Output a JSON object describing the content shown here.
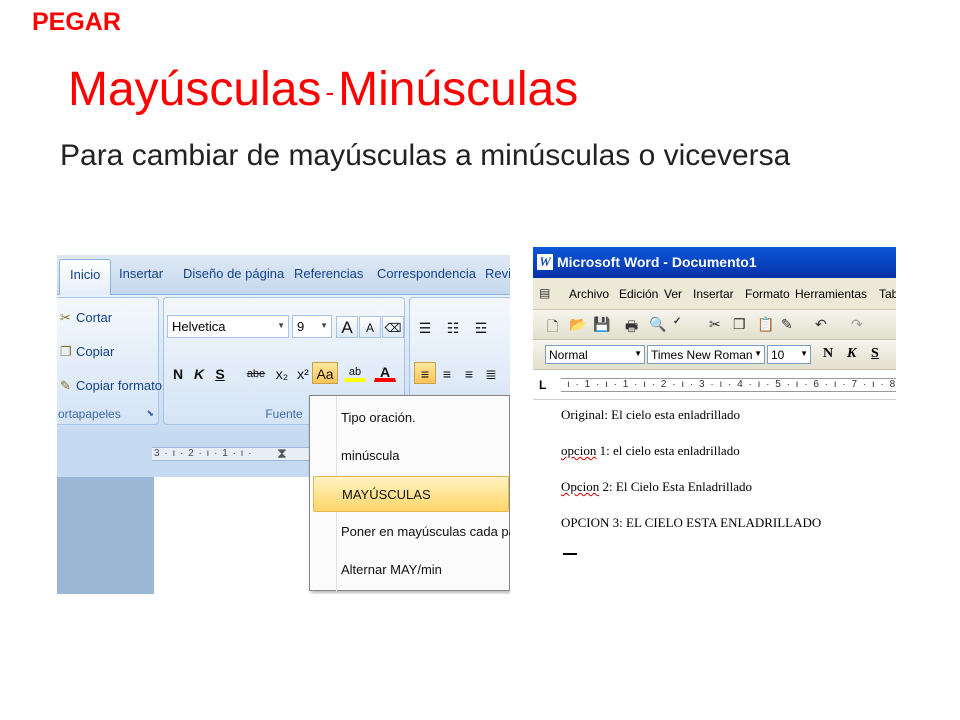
{
  "slide": {
    "top_label": "PEGAR",
    "title_left": "Mayúsculas",
    "title_separator": "-",
    "title_right": "Minúsculas",
    "intro": "Para cambiar de mayúsculas a minúsculas o viceversa"
  },
  "ribbon": {
    "tabs": [
      "Inicio",
      "Insertar",
      "Diseño de página",
      "Referencias",
      "Correspondencia",
      "Revis"
    ],
    "clipboard": {
      "cut": "Cortar",
      "copy": "Copiar",
      "format_painter": "Copiar formato",
      "group_label": "ortapapeles"
    },
    "font": {
      "name": "Helvetica",
      "size": "9",
      "group_label": "Fuente",
      "bold": "N",
      "italic": "K",
      "underline": "S",
      "strike": "abe",
      "subscript": "x₂",
      "superscript": "x²",
      "change_case": "Aa",
      "highlight": "ab",
      "font_color": "A",
      "grow": "A",
      "shrink": "A"
    },
    "ruler_text": "3 · ı · 2 · ı · 1 · ı ·",
    "case_menu": [
      "Tipo oración.",
      "minúscula",
      "MAYÚSCULAS",
      "Poner en mayúsculas cada palabra",
      "Alternar MAY/min"
    ]
  },
  "word": {
    "title": "Microsoft Word - Documento1",
    "logo": "W",
    "menus": [
      "Archivo",
      "Edición",
      "Ver",
      "Insertar",
      "Formato",
      "Herramientas",
      "Tab"
    ],
    "style": "Normal",
    "font": "Times New Roman",
    "size": "10",
    "bold": "N",
    "italic": "K",
    "underline": "S",
    "ruler_text": "ı · 1 · ı · 1 · ı · 2 · ı · 3 · ı · 4 · ı · 5 · ı · 6 · ı · 7 · ı · 8",
    "ruler_marker": "L",
    "lines": [
      "Original: El cielo esta enladrillado",
      "opcion 1: el cielo esta enladrillado",
      "Opcion 2: El Cielo Esta Enladrillado",
      "OPCION 3: EL CIELO ESTA ENLADRILLADO"
    ],
    "spell_words": [
      "opcion",
      "Opcion"
    ]
  }
}
